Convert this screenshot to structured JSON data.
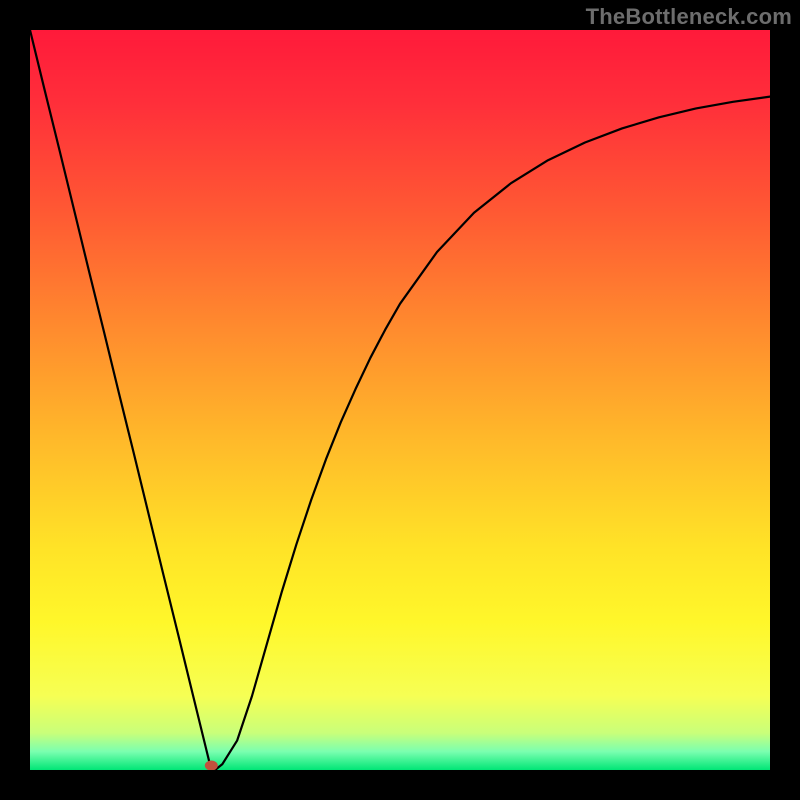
{
  "watermark": "TheBottleneck.com",
  "chart_data": {
    "type": "line",
    "title": "",
    "xlabel": "",
    "ylabel": "",
    "xlim": [
      0,
      100
    ],
    "ylim": [
      0,
      100
    ],
    "grid": false,
    "background_gradient_stops": [
      {
        "offset": 0.0,
        "color": "#ff1a3a"
      },
      {
        "offset": 0.1,
        "color": "#ff2f3a"
      },
      {
        "offset": 0.25,
        "color": "#ff5a33"
      },
      {
        "offset": 0.4,
        "color": "#ff8a2e"
      },
      {
        "offset": 0.55,
        "color": "#ffb82a"
      },
      {
        "offset": 0.7,
        "color": "#ffe327"
      },
      {
        "offset": 0.8,
        "color": "#fff72a"
      },
      {
        "offset": 0.9,
        "color": "#f6ff54"
      },
      {
        "offset": 0.95,
        "color": "#c9ff7a"
      },
      {
        "offset": 0.975,
        "color": "#7bffb0"
      },
      {
        "offset": 1.0,
        "color": "#00e676"
      }
    ],
    "x": [
      0,
      2,
      4,
      6,
      8,
      10,
      12,
      14,
      16,
      18,
      20,
      21,
      22,
      24.5,
      25,
      26,
      28,
      30,
      32,
      34,
      36,
      38,
      40,
      42,
      44,
      46,
      48,
      50,
      55,
      60,
      65,
      70,
      75,
      80,
      85,
      90,
      95,
      100
    ],
    "y": [
      100,
      91.8,
      83.7,
      75.5,
      67.3,
      59.2,
      51.0,
      42.9,
      34.7,
      26.5,
      18.4,
      14.3,
      10.2,
      0.0,
      0.0,
      0.8,
      4.0,
      10.0,
      17.0,
      24.0,
      30.5,
      36.5,
      42.0,
      47.0,
      51.5,
      55.7,
      59.5,
      63.0,
      70.0,
      75.3,
      79.3,
      82.4,
      84.8,
      86.7,
      88.2,
      89.4,
      90.3,
      91.0
    ],
    "marker": {
      "x": 24.5,
      "y": 0.6,
      "color": "#c1523d"
    },
    "annotations": []
  }
}
